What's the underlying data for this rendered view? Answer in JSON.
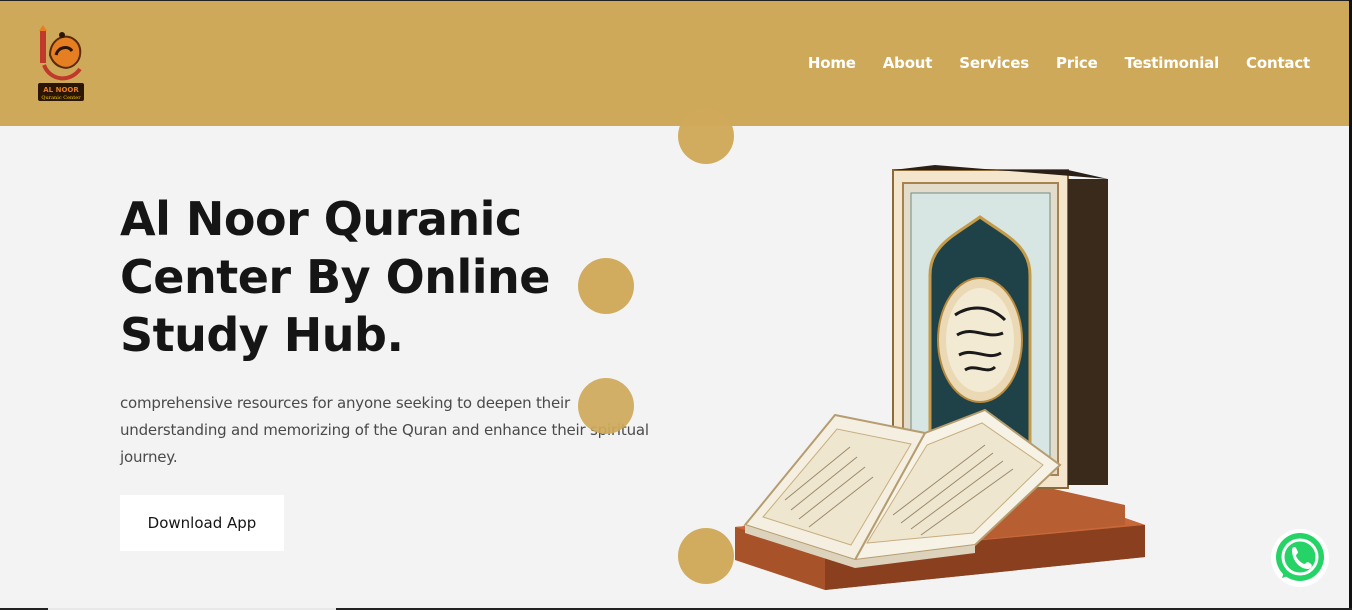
{
  "brand": {
    "logo_text": "AL NOOR",
    "logo_subtext": "Quranic Center"
  },
  "nav": {
    "items": [
      {
        "label": "Home"
      },
      {
        "label": "About"
      },
      {
        "label": "Services"
      },
      {
        "label": "Price"
      },
      {
        "label": "Testimonial"
      },
      {
        "label": "Contact"
      }
    ]
  },
  "hero": {
    "title": "Al Noor Quranic Center By Online Study Hub.",
    "description": "comprehensive resources for anyone seeking to deepen their understanding and memorizing of the Quran and enhance their spiritual journey.",
    "button_label": "Download App"
  },
  "colors": {
    "accent": "#cfa95a",
    "background": "#f3f3f3",
    "heading": "#151515",
    "whatsapp": "#25d366"
  },
  "icons": {
    "logo": "mosque-calligraphy-logo",
    "floating": "whatsapp-icon",
    "hero_image": "quran-book-on-stand"
  }
}
